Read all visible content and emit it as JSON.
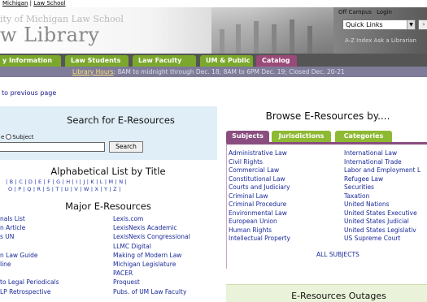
{
  "topstrip": {
    "crumb_a": "Michigan",
    "sep": " | ",
    "crumb_b": "Law School"
  },
  "banner": {
    "university": "ity of Michigan Law School",
    "library": "w Library",
    "util_campus": "Off Campus",
    "util_login": "Login",
    "quicklinks_value": "Quick Links",
    "az": "A-Z Index    Ask a Librarian"
  },
  "nav": {
    "info": "y Information",
    "students": "Law Students",
    "faculty": "Law Faculty",
    "public": "UM & Public",
    "catalog": "Catalog"
  },
  "hours": {
    "link": "Library Hours",
    "text": ": 8AM to midnight through Dec. 18; 8AM to 6PM Dec. 19; Closed Dec. 20-21"
  },
  "back": "to previous page",
  "search": {
    "title": "Search for E-Resources",
    "radio_a": "e",
    "radio_b": "Subject",
    "button": "Search"
  },
  "alpha": {
    "title": "Alphabetical List by Title",
    "row1": "|  B | C | D | E | F | G | H | I | J | K | L | M | N |",
    "row2": "O | P | Q | R | S | T | U | V | W | X | Y | Z |"
  },
  "major": {
    "title": "Major E-Resources",
    "col_a": [
      "nals List",
      "n Article",
      "s UN",
      "",
      "n Law Guide",
      "line",
      "",
      "to Legal Periodicals",
      "LP Retrospective"
    ],
    "col_b": [
      "Lexis.com",
      "LexisNexis Academic",
      "LexisNexis Congressional",
      "LLMC Digital",
      "Making of Modern Law",
      "Michigan Legislature",
      "PACER",
      "Proquest",
      "Pubs. of UM Law Faculty"
    ]
  },
  "browse": {
    "title": "Browse E-Resources by....",
    "tabs": {
      "subjects": "Subjects",
      "jurisdictions": "Jurisdictions",
      "categories": "Categories"
    },
    "col1": [
      "Administrative Law",
      "Civil Rights",
      "Commercial Law",
      "Constitutional Law",
      "Courts and Judiciary",
      "Criminal Law",
      "Criminal Procedure",
      "Environmental Law",
      "European Union",
      "Human Rights",
      "Intellectual Property"
    ],
    "col2": [
      "International Law",
      "International Trade",
      "Labor and Employment L",
      "Refugee Law",
      "Securities",
      "Taxation",
      "United Nations",
      "United States Executive",
      "United States Judicial",
      "United States Legislativ",
      "US Supreme Court"
    ],
    "all": "ALL SUBJECTS"
  },
  "outages": {
    "title": "E-Resources Outages"
  }
}
